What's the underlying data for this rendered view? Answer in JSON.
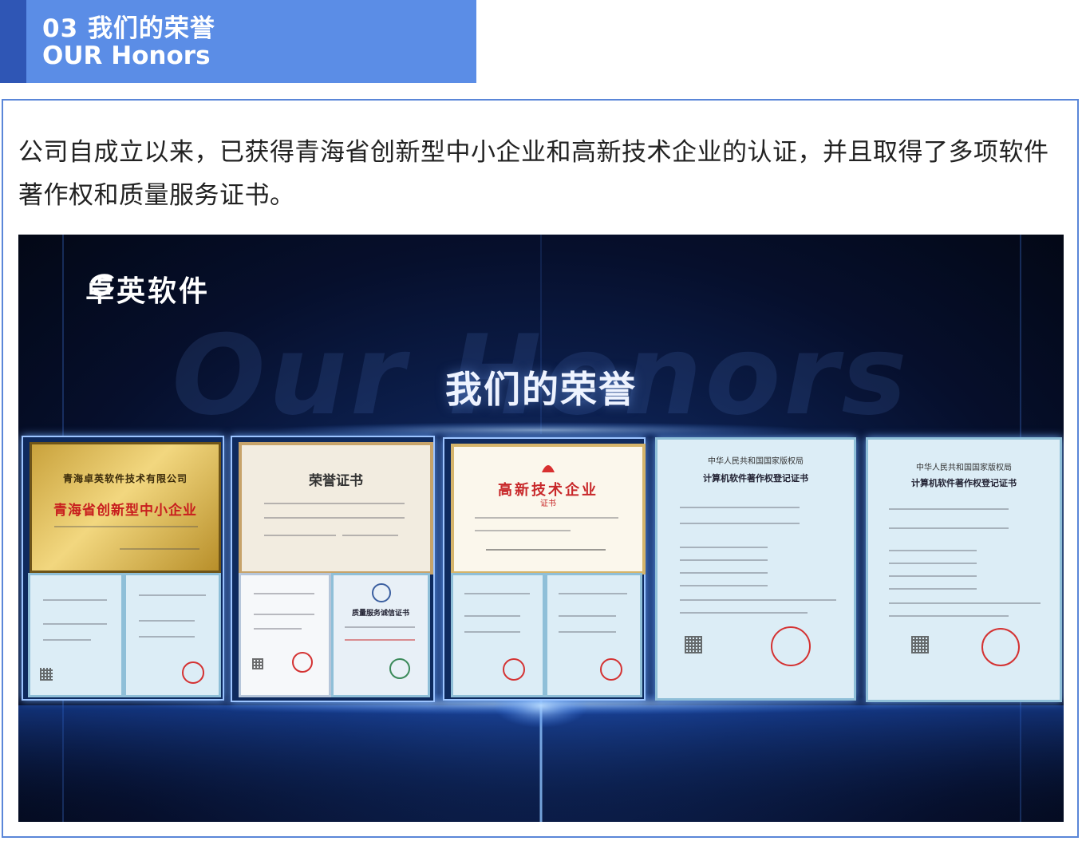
{
  "header": {
    "number": "03",
    "title_cn": "我们的荣誉",
    "title_en": "OUR Honors"
  },
  "intro": "公司自成立以来，已获得青海省创新型中小企业和高新技术企业的认证，并且取得了多项软件著作权和质量服务证书。",
  "image": {
    "brand": "卓英软件",
    "background_word": "Our Honors",
    "title": "我们的荣誉",
    "certificates": {
      "plaque_org": "青海卓英软件技术有限公司",
      "plaque_title": "青海省创新型中小企业",
      "honor_title": "荣誉证书",
      "hightech_title": "高新技术企业",
      "hightech_sub": "证书",
      "quality_title": "质量服务诚信证书",
      "copyright_header": "中华人民共和国国家版权局",
      "copyright_title": "计算机软件著作权登记证书"
    }
  },
  "colors": {
    "header_band": "#5b8de6",
    "header_accent": "#2f56b5",
    "card_border": "#5a86d8",
    "panel_bg": "#0c1f4d"
  }
}
